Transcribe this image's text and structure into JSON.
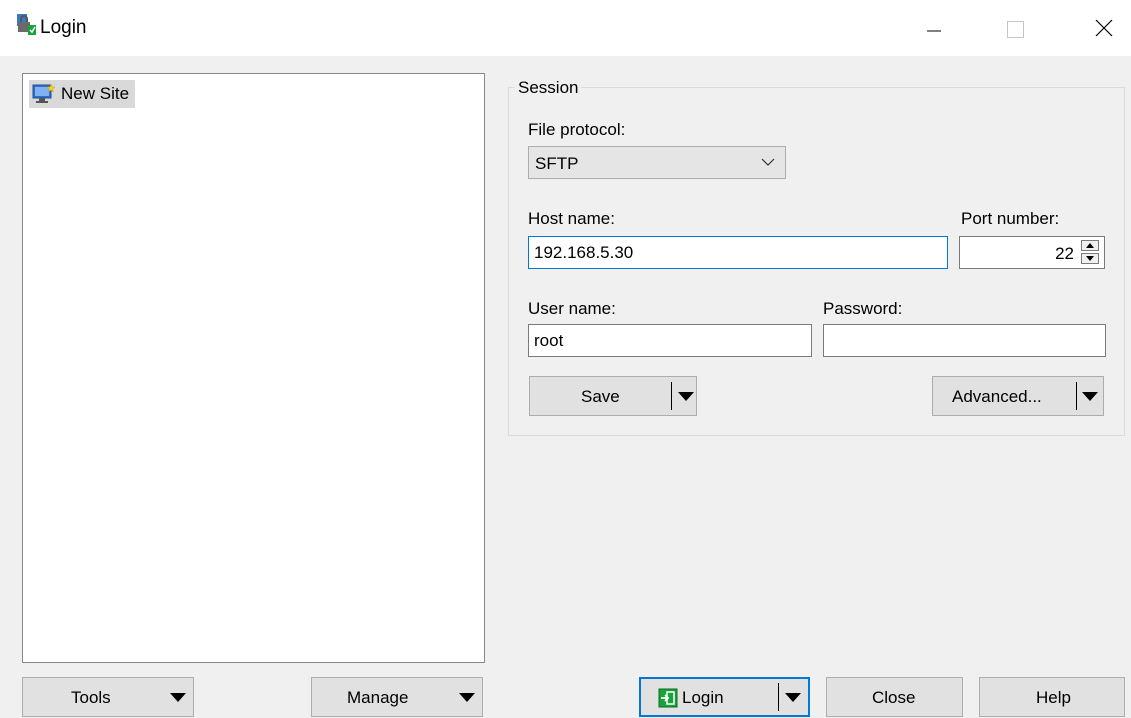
{
  "window": {
    "title": "Login"
  },
  "sites": [
    {
      "label": "New Site"
    }
  ],
  "session": {
    "legend": "Session",
    "protocol_label": "File protocol:",
    "protocol_value": "SFTP",
    "host_label": "Host name:",
    "host_value": "192.168.5.30",
    "port_label": "Port number:",
    "port_value": "22",
    "user_label": "User name:",
    "user_value": "root",
    "password_label": "Password:",
    "password_value": "",
    "save_label": "Save",
    "advanced_label": "Advanced..."
  },
  "bottom": {
    "tools_label": "Tools",
    "manage_label": "Manage",
    "login_label": "Login",
    "close_label": "Close",
    "help_label": "Help"
  },
  "colors": {
    "accent": "#0078d7",
    "login_icon": "#1aa33a"
  }
}
